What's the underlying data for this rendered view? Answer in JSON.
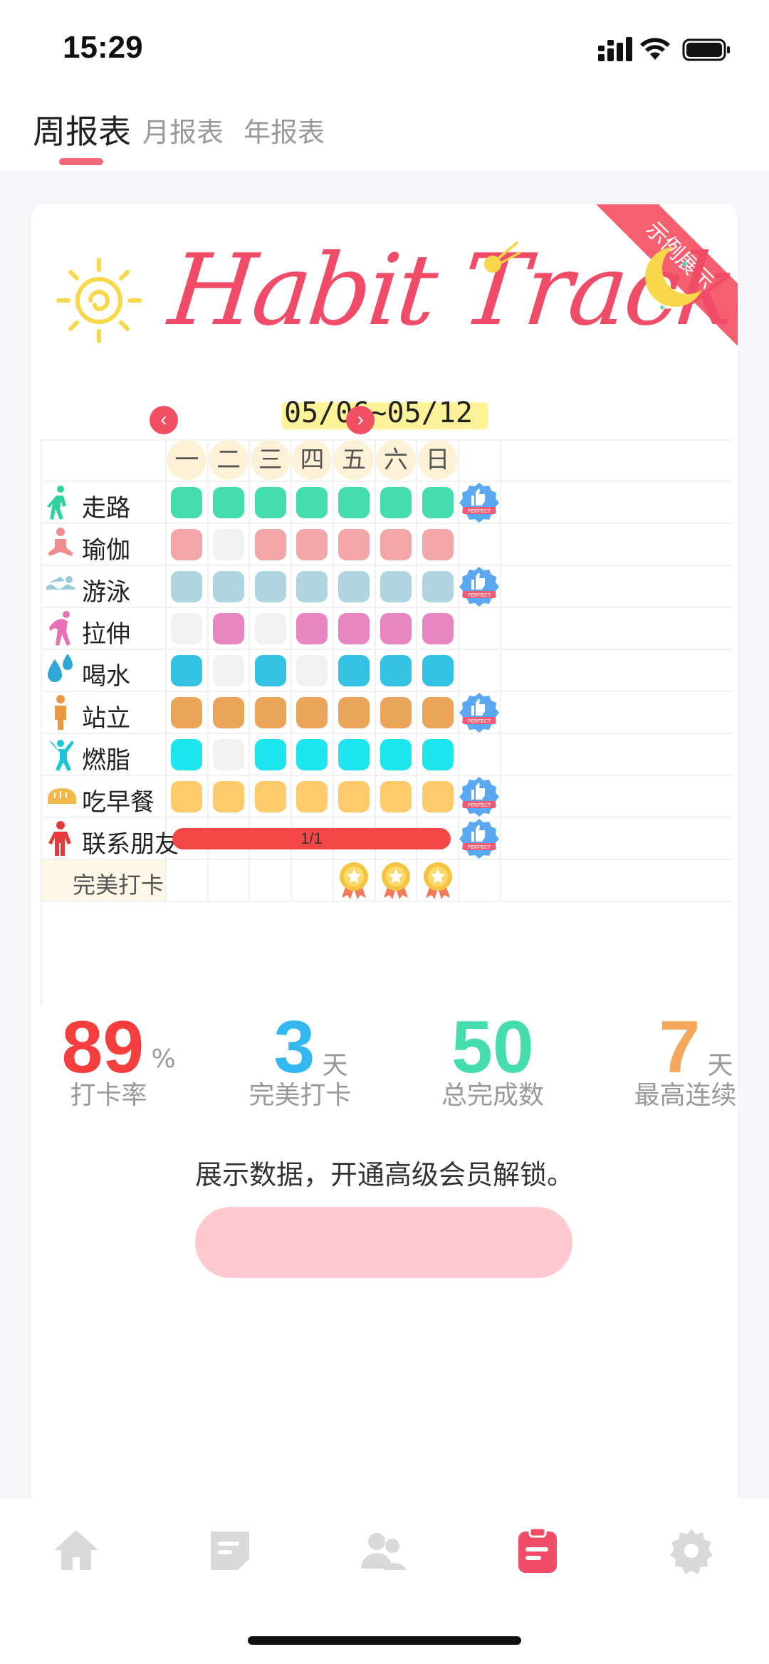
{
  "status": {
    "time": "15:29"
  },
  "tabs": [
    {
      "label": "周报表",
      "active": true
    },
    {
      "label": "月报表",
      "active": false
    },
    {
      "label": "年报表",
      "active": false
    }
  ],
  "card": {
    "ribbon": "示例展示",
    "title": "Habit Tracker",
    "date_range": "05/06~05/12",
    "days": [
      "一",
      "二",
      "三",
      "四",
      "五",
      "六",
      "日"
    ],
    "habits": [
      {
        "name": "走路",
        "icon": "walking-icon",
        "color": "#45dcae",
        "done": [
          1,
          1,
          1,
          1,
          1,
          1,
          1
        ],
        "perfect": true
      },
      {
        "name": "瑜伽",
        "icon": "yoga-icon",
        "color": "#f2a6a8",
        "done": [
          1,
          0,
          1,
          1,
          1,
          1,
          1
        ],
        "perfect": false
      },
      {
        "name": "游泳",
        "icon": "swimming-icon",
        "color": "#aed5e0",
        "done": [
          1,
          1,
          1,
          1,
          1,
          1,
          1
        ],
        "perfect": true
      },
      {
        "name": "拉伸",
        "icon": "stretching-icon",
        "color": "#e886c1",
        "done": [
          0,
          1,
          0,
          1,
          1,
          1,
          1
        ],
        "perfect": false
      },
      {
        "name": "喝水",
        "icon": "water-drop-icon",
        "color": "#33c1e4",
        "done": [
          1,
          0,
          1,
          0,
          1,
          1,
          1
        ],
        "perfect": false
      },
      {
        "name": "站立",
        "icon": "standing-icon",
        "color": "#eba55a",
        "done": [
          1,
          1,
          1,
          1,
          1,
          1,
          1
        ],
        "perfect": true
      },
      {
        "name": "燃脂",
        "icon": "fat-burn-icon",
        "color": "#1ee6ee",
        "done": [
          1,
          0,
          1,
          1,
          1,
          1,
          1
        ],
        "perfect": false
      },
      {
        "name": "吃早餐",
        "icon": "bread-icon",
        "color": "#fdcb6c",
        "done": [
          1,
          1,
          1,
          1,
          1,
          1,
          1
        ],
        "perfect": true
      },
      {
        "name": "联系朋友",
        "icon": "person-icon",
        "color": "#f44848",
        "progress": "1/1",
        "perfect": true
      }
    ],
    "perfect_row": {
      "label": "完美打卡",
      "medals": [
        0,
        0,
        0,
        0,
        1,
        1,
        1
      ]
    },
    "badge_text": "PERFECT",
    "stats": [
      {
        "value": "89",
        "unit": "%",
        "label": "打卡率",
        "color": "#f43d3d"
      },
      {
        "value": "3",
        "unit": "天",
        "label": "完美打卡",
        "color": "#33b8f0"
      },
      {
        "value": "50",
        "unit": "",
        "label": "总完成数",
        "color": "#45dcae"
      },
      {
        "value": "7",
        "unit": "天",
        "label": "最高连续",
        "color": "#f4a85c"
      }
    ],
    "unlock_text": "展示数据，开通高级会员解锁。"
  },
  "bottom_nav": [
    "home-icon",
    "notes-icon",
    "friends-icon",
    "report-icon",
    "settings-icon"
  ],
  "colors": {
    "accent": "#f26a7a",
    "inactive_nav": "#d9d9d9",
    "empty_cell": "#f1f1f1"
  }
}
